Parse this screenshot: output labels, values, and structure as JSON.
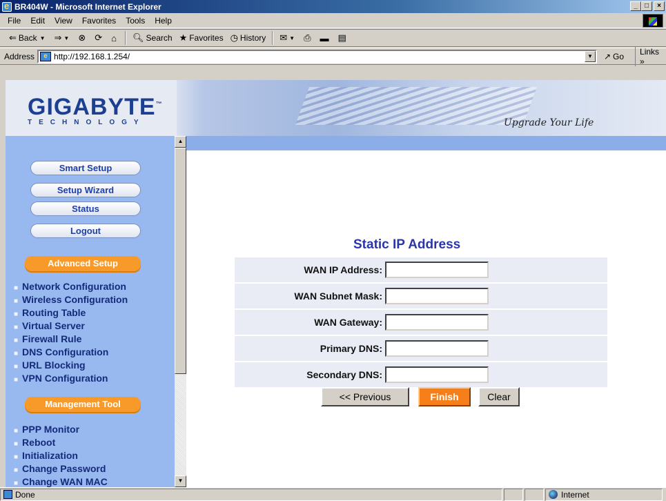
{
  "window": {
    "title": "BR404W - Microsoft Internet Explorer",
    "controls": [
      "_",
      "□",
      "×"
    ]
  },
  "menu": {
    "file": "File",
    "edit": "Edit",
    "view": "View",
    "favorites": "Favorites",
    "tools": "Tools",
    "help": "Help"
  },
  "toolbar": {
    "back": "Back",
    "search": "Search",
    "favorites": "Favorites",
    "history": "History"
  },
  "address": {
    "label": "Address",
    "url": "http://192.168.1.254/",
    "go": "Go",
    "links": "Links »"
  },
  "banner": {
    "logo": "GIGABYTE",
    "logo_tm": "™",
    "logo_sub": "TECHNOLOGY",
    "tagline": "Upgrade Your Life"
  },
  "nav": {
    "buttons": [
      "Smart Setup",
      "Setup Wizard",
      "Status",
      "Logout"
    ],
    "advanced_header": "Advanced Setup",
    "advanced_links": [
      "Network Configuration",
      "Wireless Configuration",
      "Routing Table",
      "Virtual Server",
      "Firewall Rule",
      "DNS Configuration",
      "URL Blocking",
      "VPN Configuration"
    ],
    "management_header": "Management Tool",
    "management_links": [
      "PPP Monitor",
      "Reboot",
      "Initialization",
      "Change Password",
      "Change WAN MAC"
    ]
  },
  "form": {
    "title": "Static IP Address",
    "fields": [
      {
        "label": "WAN IP Address:",
        "value": ""
      },
      {
        "label": "WAN Subnet Mask:",
        "value": ""
      },
      {
        "label": "WAN Gateway:",
        "value": ""
      },
      {
        "label": "Primary DNS:",
        "value": ""
      },
      {
        "label": "Secondary DNS:",
        "value": ""
      }
    ],
    "previous": "<< Previous",
    "finish": "Finish",
    "clear": "Clear"
  },
  "status": {
    "text": "Done",
    "zone": "Internet"
  },
  "colors": {
    "nav_bg": "#98b8f0",
    "accent_orange": "#f77f1a",
    "title_blue": "#2a36a8"
  }
}
